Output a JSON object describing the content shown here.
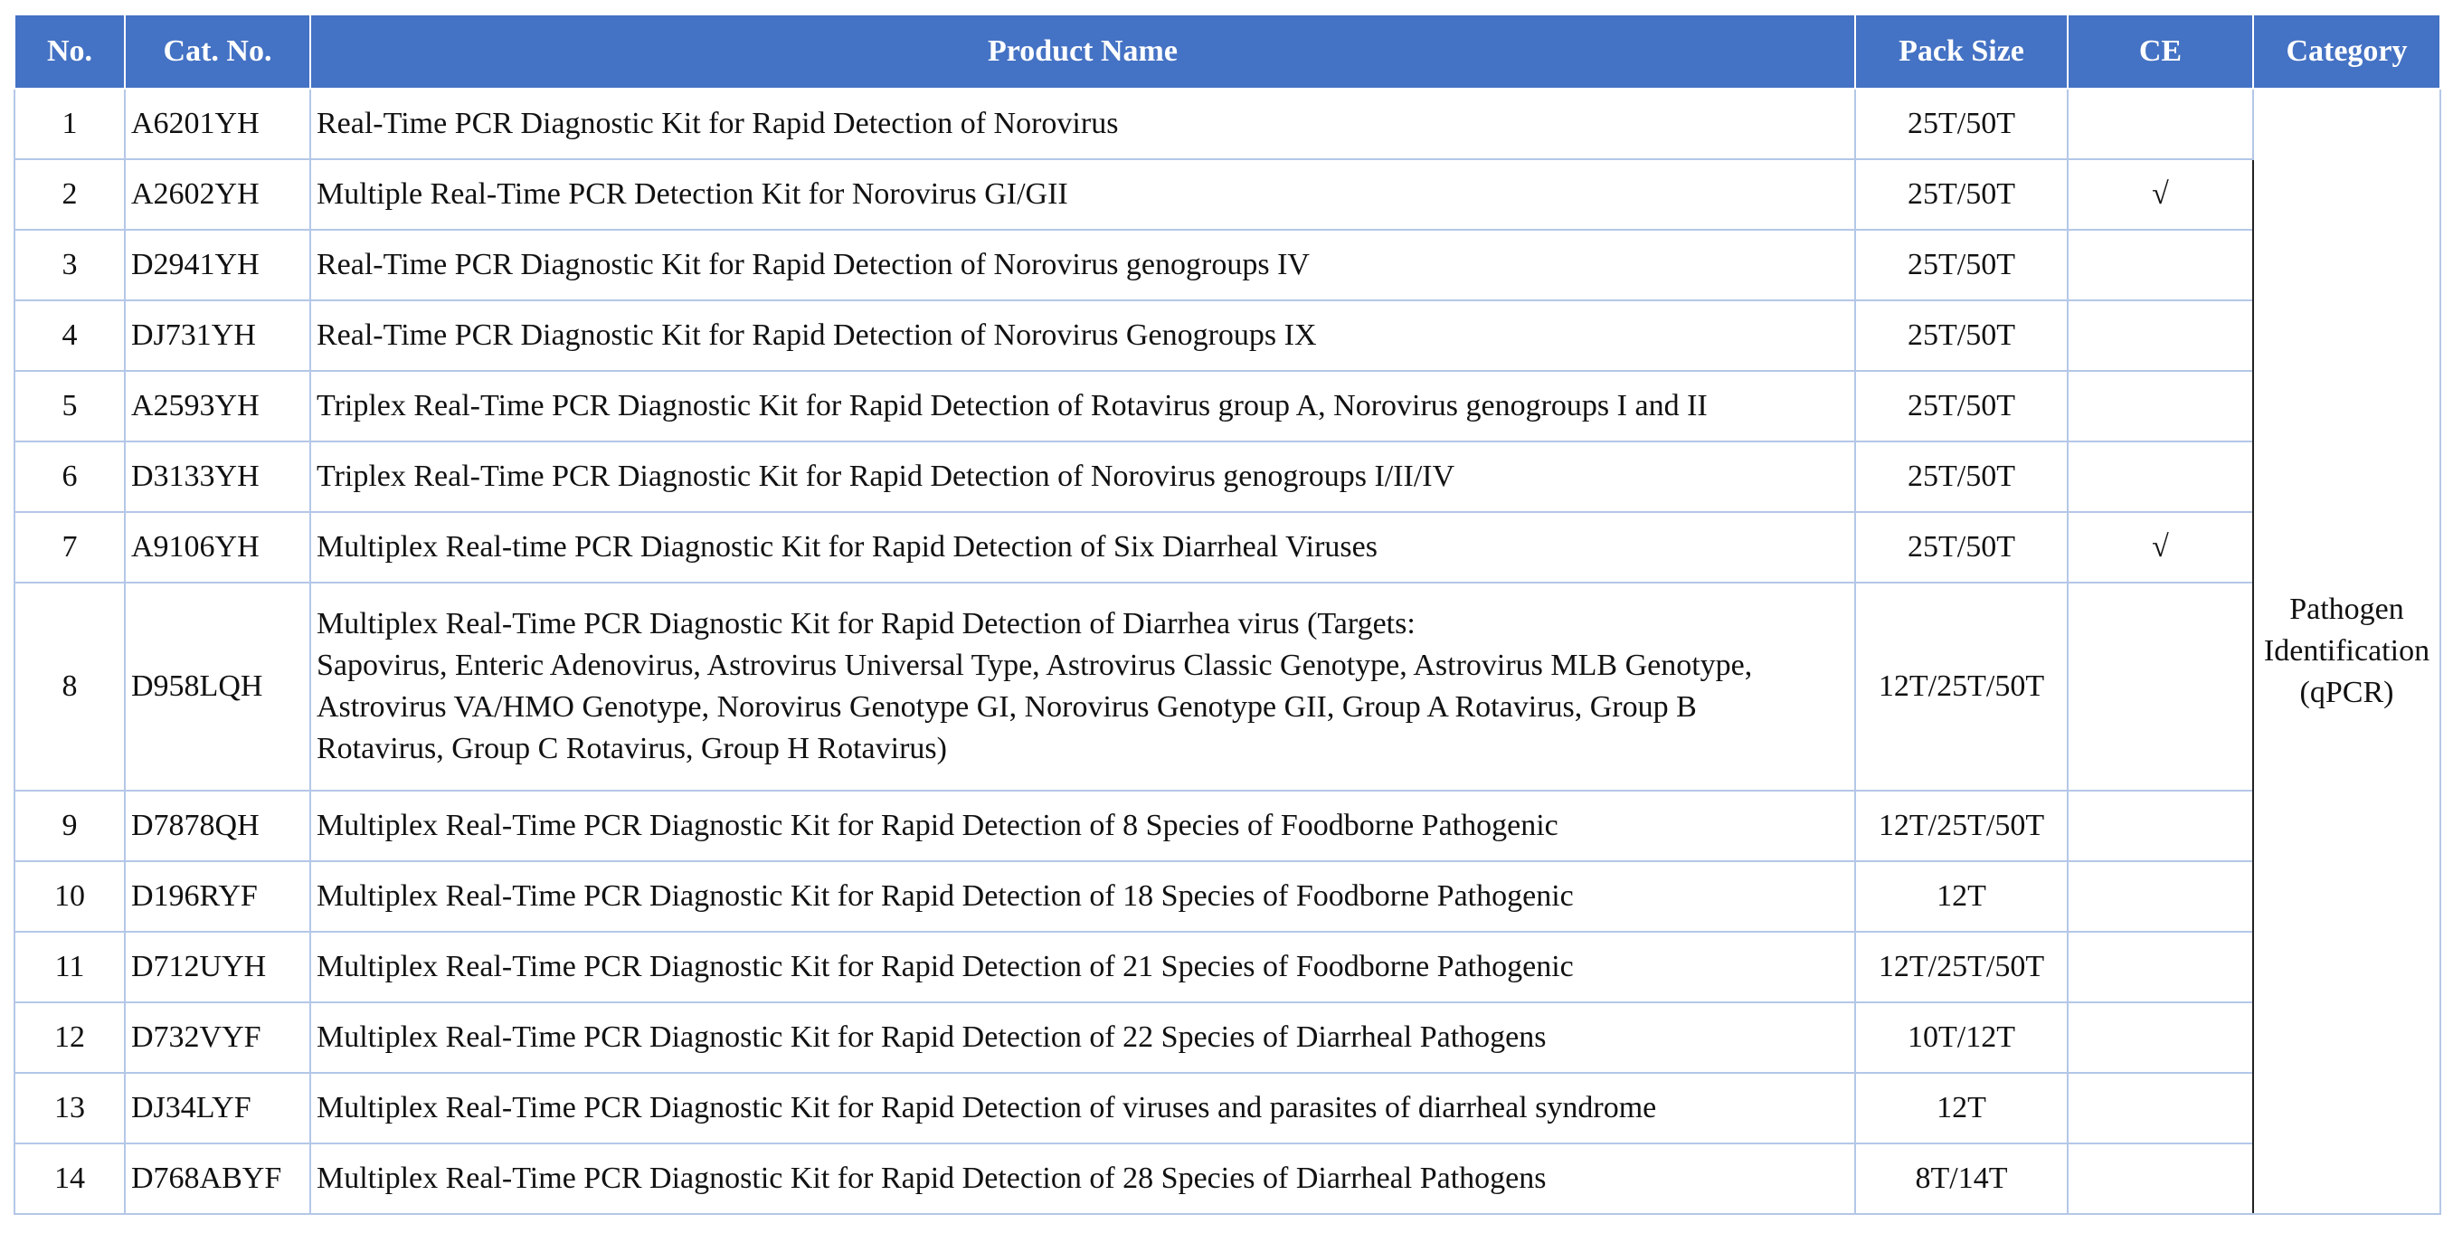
{
  "headers": {
    "no": "No.",
    "cat_no": "Cat. No.",
    "product_name": "Product Name",
    "pack_size": "Pack Size",
    "ce": "CE",
    "category": "Category"
  },
  "category_value": "Pathogen\nIdentification\n(qPCR)",
  "rows": [
    {
      "no": "1",
      "cat_no": "A6201YH",
      "name": "Real-Time PCR Diagnostic Kit for Rapid Detection of Norovirus",
      "pack": "25T/50T",
      "ce": ""
    },
    {
      "no": "2",
      "cat_no": "A2602YH",
      "name": "Multiple Real-Time PCR Detection Kit for Norovirus GI/GII",
      "pack": "25T/50T",
      "ce": "√"
    },
    {
      "no": "3",
      "cat_no": "D2941YH",
      "name": "Real-Time PCR Diagnostic Kit for Rapid Detection of Norovirus genogroups IV",
      "pack": "25T/50T",
      "ce": ""
    },
    {
      "no": "4",
      "cat_no": "DJ731YH",
      "name": "Real-Time PCR Diagnostic Kit for Rapid Detection of Norovirus Genogroups IX",
      "pack": "25T/50T",
      "ce": ""
    },
    {
      "no": "5",
      "cat_no": "A2593YH",
      "name": "Triplex Real-Time PCR Diagnostic Kit for Rapid Detection of Rotavirus group A, Norovirus genogroups I and II",
      "pack": "25T/50T",
      "ce": ""
    },
    {
      "no": "6",
      "cat_no": "D3133YH",
      "name": "Triplex Real-Time PCR Diagnostic Kit for Rapid Detection of Norovirus genogroups I/II/IV",
      "pack": "25T/50T",
      "ce": ""
    },
    {
      "no": "7",
      "cat_no": "A9106YH",
      "name": "Multiplex Real-time PCR Diagnostic Kit for Rapid Detection of Six Diarrheal Viruses",
      "pack": "25T/50T",
      "ce": "√"
    },
    {
      "no": "8",
      "cat_no": "D958LQH",
      "name": "Multiplex Real-Time PCR Diagnostic Kit for Rapid Detection of Diarrhea virus (Targets:\nSapovirus, Enteric Adenovirus, Astrovirus Universal Type, Astrovirus Classic Genotype, Astrovirus MLB Genotype,\nAstrovirus VA/HMO Genotype, Norovirus Genotype GI, Norovirus Genotype GII, Group A Rotavirus, Group B\nRotavirus, Group C Rotavirus, Group H Rotavirus)",
      "pack": "12T/25T/50T",
      "ce": ""
    },
    {
      "no": "9",
      "cat_no": "D7878QH",
      "name": "Multiplex Real-Time PCR Diagnostic Kit for Rapid Detection of 8 Species of Foodborne Pathogenic",
      "pack": "12T/25T/50T",
      "ce": ""
    },
    {
      "no": "10",
      "cat_no": "D196RYF",
      "name": "Multiplex Real-Time PCR Diagnostic Kit for Rapid Detection of 18 Species of Foodborne Pathogenic",
      "pack": "12T",
      "ce": ""
    },
    {
      "no": "11",
      "cat_no": "D712UYH",
      "name": "Multiplex Real-Time PCR Diagnostic Kit for Rapid Detection of 21 Species of Foodborne Pathogenic",
      "pack": "12T/25T/50T",
      "ce": ""
    },
    {
      "no": "12",
      "cat_no": "D732VYF",
      "name": "Multiplex Real-Time PCR Diagnostic Kit for Rapid Detection of 22 Species of Diarrheal Pathogens",
      "pack": "10T/12T",
      "ce": ""
    },
    {
      "no": "13",
      "cat_no": "DJ34LYF",
      "name": "Multiplex Real-Time PCR Diagnostic Kit for Rapid Detection of viruses and parasites of diarrheal syndrome",
      "pack": "12T",
      "ce": ""
    },
    {
      "no": "14",
      "cat_no": "D768ABYF",
      "name": "Multiplex Real-Time PCR Diagnostic Kit for Rapid Detection of 28 Species of Diarrheal Pathogens",
      "pack": "8T/14T",
      "ce": ""
    }
  ]
}
